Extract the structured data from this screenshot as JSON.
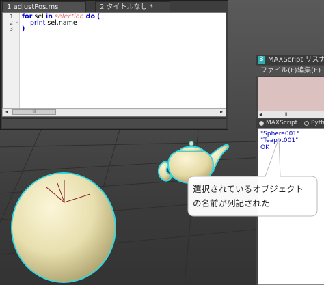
{
  "editor": {
    "tabs": [
      {
        "number": "1",
        "label": "adjustPos.ms"
      },
      {
        "number": "2",
        "label": "タイトルなし *"
      }
    ],
    "line_numbers": [
      "1",
      "2",
      "3"
    ],
    "code": {
      "line1": {
        "kw_for": "for",
        "var": "sel",
        "kw_in": "in",
        "builtin": "selection",
        "kw_do": "do",
        "paren": "("
      },
      "line2": {
        "kw_print": "print",
        "expr": "sel.name"
      },
      "line3": {
        "paren": ")"
      }
    },
    "scrollbar": {
      "left": "◂",
      "thumb": "III",
      "right": "▸"
    }
  },
  "listener": {
    "icon": "3",
    "title": "MAXScript リスナー",
    "menu": [
      "ファイル(F)",
      "編集(E)"
    ],
    "macro_scroll": {
      "left": "◂",
      "thumb": "III"
    },
    "tabs": [
      {
        "label": "MAXScript",
        "selected": true
      },
      {
        "label": "Pytho",
        "selected": false
      }
    ],
    "output": [
      "\"Sphere001\"",
      "\"Teapot001\"",
      "OK"
    ]
  },
  "callout": {
    "line1": "選択されているオブジェクト",
    "line2": "の名前が列記された"
  },
  "colors": {
    "keyword": "#0000cc",
    "builtin": "#e06a6a",
    "output_text": "#0000c8",
    "selection_outline": "#2fd8e0",
    "object_fill": "#e8dfae"
  },
  "icons": {
    "listener_icon": "maxscript-3-icon",
    "fold": "fold-line-icon"
  }
}
